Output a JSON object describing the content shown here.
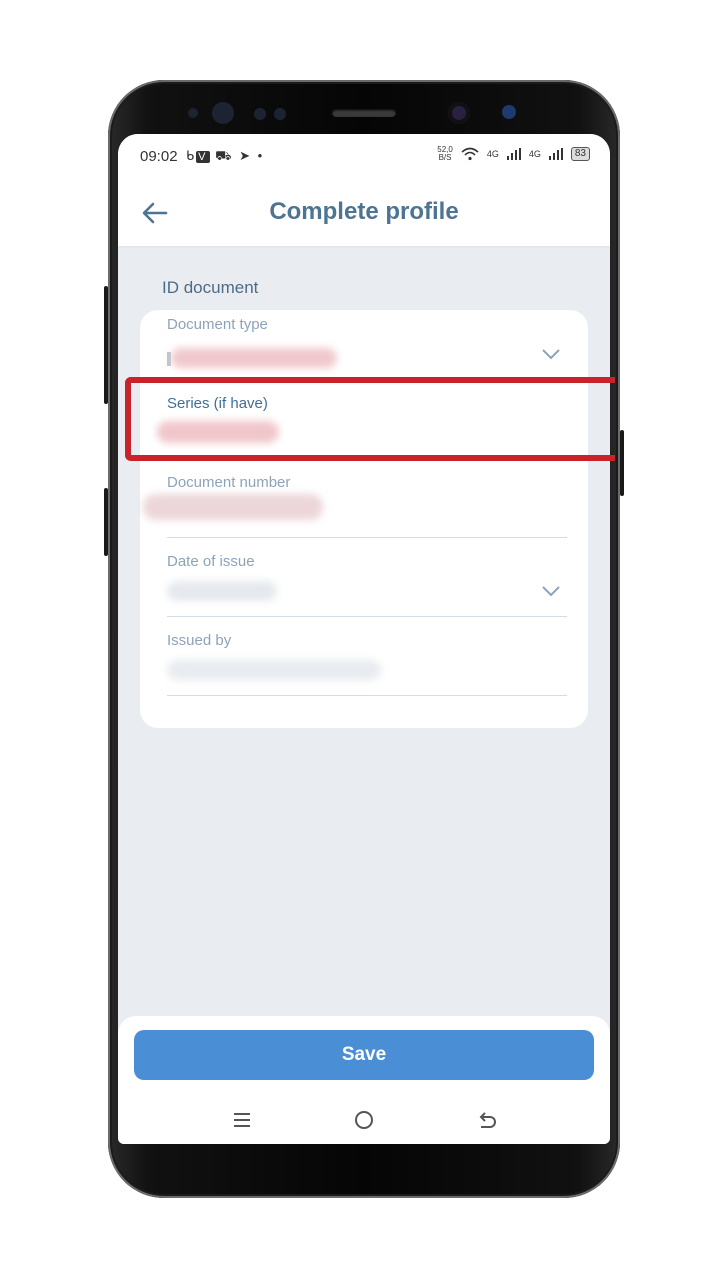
{
  "status_bar": {
    "time": "09:02",
    "notif_icons": [
      "b-icon",
      "v-icon",
      "cart-icon",
      "telegram-icon",
      "dot-icon"
    ],
    "net_speed_value": "52,0",
    "net_speed_unit": "B/S",
    "network_1": "4G",
    "network_2": "4G",
    "battery": "83"
  },
  "app_bar": {
    "title": "Complete profile"
  },
  "section": {
    "title": "ID document"
  },
  "fields": [
    {
      "label": "Document type",
      "has_dropdown": true
    },
    {
      "label": "Series (if have)",
      "active": true
    },
    {
      "label": "Document number"
    },
    {
      "label": "Date of issue",
      "has_dropdown": true
    },
    {
      "label": "Issued by"
    }
  ],
  "footer": {
    "save_label": "Save"
  },
  "colors": {
    "accent": "#4a8ed5",
    "title": "#4d7592",
    "highlight": "#c8232a",
    "screen_bg": "#e9edf2"
  }
}
